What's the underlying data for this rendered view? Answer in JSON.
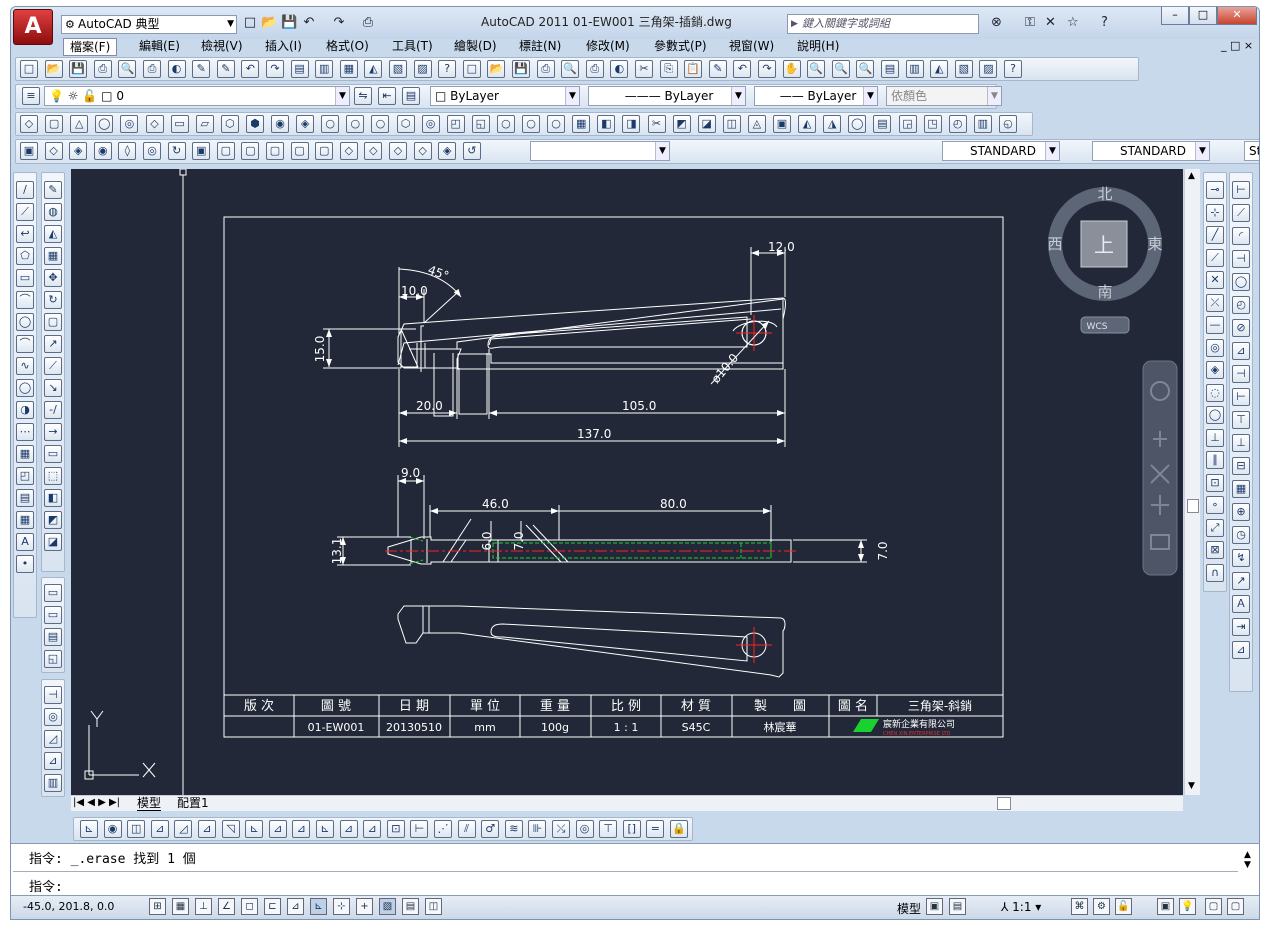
{
  "app": {
    "logo": "A",
    "title": "AutoCAD 2011      01-EW001 三角架-插銷.dwg",
    "workspace": "AutoCAD 典型",
    "search_placeholder": "鍵入關鍵字或詞組",
    "window_controls": [
      "–",
      "□",
      "✕"
    ],
    "doc_controls": [
      "_",
      "□",
      "×"
    ]
  },
  "menu": [
    "檔案(F)",
    "編輯(E)",
    "檢視(V)",
    "插入(I)",
    "格式(O)",
    "工具(T)",
    "繪製(D)",
    "標註(N)",
    "修改(M)",
    "參數式(P)",
    "視窗(W)",
    "說明(H)"
  ],
  "layer_toolbar": {
    "current_layer": "0",
    "color": "ByLayer",
    "linetype": "ByLayer",
    "lineweight": "ByLayer",
    "plot_style": "依顏色"
  },
  "styles_toolbar": {
    "text_style": "STANDARD",
    "dim_style": "STANDARD",
    "table_style": "Sta"
  },
  "viewcube": {
    "north": "北",
    "south": "南",
    "east": "東",
    "west": "西",
    "top": "上",
    "wcs": "WCS"
  },
  "drawing": {
    "dims": {
      "d12": "12.0",
      "d45": "45°",
      "d10": "10.0",
      "d15": "15.0",
      "d20": "20.0",
      "d105": "105.0",
      "d137": "137.0",
      "dia10": "ø10.0",
      "d9": "9.0",
      "d46": "46.0",
      "d80": "80.0",
      "d6": "6.0",
      "d7a": "7.0",
      "d131": "13.1",
      "d7b": "7.0"
    },
    "title_block": {
      "headers": [
        "版 次",
        "圖 號",
        "日 期",
        "單 位",
        "重 量",
        "比 例",
        "材 質",
        "製　　圖",
        "圖 名"
      ],
      "drawing_name": "三角架-斜銷",
      "values": [
        "",
        "01-EW001",
        "20130510",
        "mm",
        "100g",
        "1 : 1",
        "S45C",
        "林宸華"
      ],
      "company_cn": "宸新企業有限公司",
      "company_en": "CHEN XIN ENTERPRISE LTD"
    },
    "ucs": {
      "x": "X",
      "y": "Y"
    }
  },
  "tabs": {
    "model": "模型",
    "layout": "配置1"
  },
  "command": {
    "history": "指令: _.erase 找到 1 個",
    "prompt": "指令:"
  },
  "status": {
    "coords": "-45.0, 201.8, 0.0",
    "model": "模型",
    "scale": "1:1"
  },
  "colors": {
    "canvas": "#222837",
    "frame": "#c9d9ec",
    "geometry": "#ffffff",
    "centerline": "#ff2020",
    "hidden": "#19d12f",
    "dim": "#ffffff"
  }
}
